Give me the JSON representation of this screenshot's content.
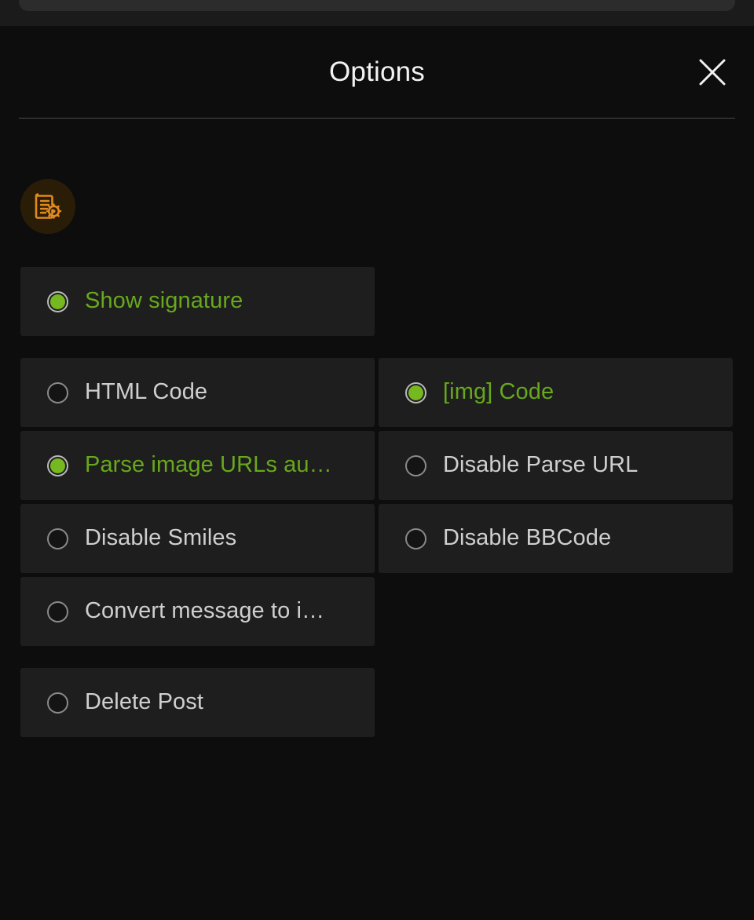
{
  "window": {
    "background_color": "#0d0d0d",
    "host_panel_color": "#2c2c2c"
  },
  "header": {
    "title": "Options",
    "close_icon": "close-icon",
    "close_label": "Close"
  },
  "body": {
    "badge": {
      "icon": "document-gear-icon",
      "icon_color": "#e08a1e",
      "background_color": "#2a1d08"
    }
  },
  "colors": {
    "selected_text": "#67a81c",
    "selected_dot": "#76b81f",
    "unselected_text": "#cfcfcf",
    "row_background": "#1e1e1e",
    "divider": "#4a4a4a"
  },
  "options": {
    "rows": [
      {
        "cells": [
          {
            "label": "Show signature",
            "selected": true,
            "name": "option-show-signature"
          },
          {
            "label": "",
            "selected": false,
            "name": "option-empty",
            "empty": true
          }
        ]
      },
      {
        "cells": [
          {
            "label": "HTML Code",
            "selected": false,
            "name": "option-html-code"
          },
          {
            "label": "[img] Code",
            "selected": true,
            "name": "option-img-code"
          }
        ]
      },
      {
        "cells": [
          {
            "label": "Parse image URLs au…",
            "selected": true,
            "name": "option-parse-image-urls"
          },
          {
            "label": "Disable Parse URL",
            "selected": false,
            "name": "option-disable-parse-url"
          }
        ]
      },
      {
        "cells": [
          {
            "label": "Disable Smiles",
            "selected": false,
            "name": "option-disable-smiles"
          },
          {
            "label": "Disable BBCode",
            "selected": false,
            "name": "option-disable-bbcode"
          }
        ]
      },
      {
        "cells": [
          {
            "label": "Convert message to i…",
            "selected": false,
            "name": "option-convert-message"
          },
          {
            "label": "",
            "selected": false,
            "name": "option-empty",
            "empty": true
          }
        ]
      },
      {
        "cells": [
          {
            "label": "Delete Post",
            "selected": false,
            "name": "option-delete-post"
          },
          {
            "label": "",
            "selected": false,
            "name": "option-empty",
            "empty": true
          }
        ]
      }
    ]
  }
}
